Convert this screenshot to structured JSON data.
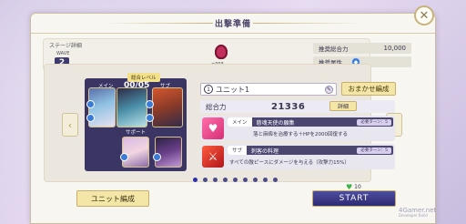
{
  "header": {
    "title": "出撃準備"
  },
  "stage": {
    "label": "ステージ詳細",
    "wave_label": "WAVE",
    "wave_value": "2",
    "enemy_count": "×003"
  },
  "recommend": {
    "power_label": "推奨総合力",
    "power_value": "10,000",
    "attribute_label": "推奨属性",
    "attribute_icon": "water-element-icon"
  },
  "team": {
    "level_label": "総合レベル",
    "member_count": "00/05",
    "main_label": "メイン",
    "sub_label": "サブ",
    "support_label": "サポート"
  },
  "unit": {
    "number": "1",
    "name": "ユニット1",
    "auto_button": "おまかせ編成",
    "power_label": "総合力",
    "power_value": "21336",
    "detail_button": "詳細"
  },
  "skills": [
    {
      "type": "メイン",
      "name": "慈魂天使の願集",
      "turn": "必要ターン：5",
      "desc": "落と麻痺を治療する＋HPを2000回復する"
    },
    {
      "type": "サブ",
      "name": "刺客の料理",
      "turn": "必要ターン：5",
      "desc": "すべての敵ピースにダメージを与える（攻撃力15%）"
    }
  ],
  "pagination": {
    "total": 9,
    "active": 0
  },
  "footer": {
    "unit_edit_button": "ユニット編成",
    "stamina_value": "10",
    "start_button": "START"
  },
  "watermark": {
    "main": "4Gamer.net",
    "sub": "Developer Build"
  }
}
